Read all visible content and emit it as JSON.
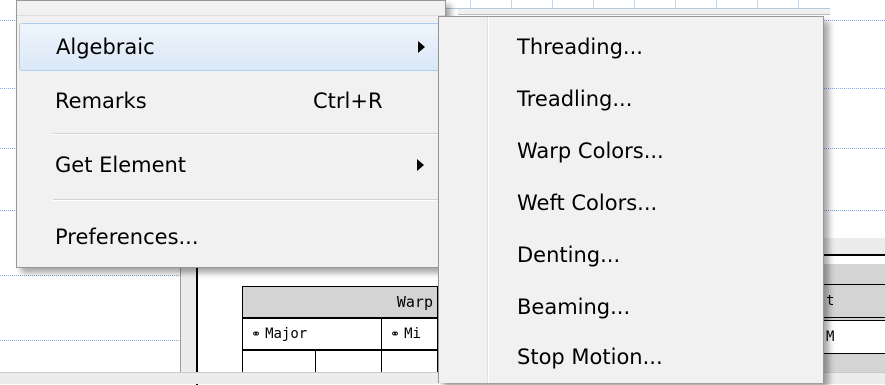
{
  "background": {
    "warp_header": "Warp",
    "col_major": "Major",
    "col_minor": "Mi",
    "lock_glyph": "🔒",
    "right_stub_a": "t",
    "right_stub_b": "M"
  },
  "menu": {
    "items": [
      {
        "label": "Algebraic",
        "shortcut": "",
        "has_submenu": true,
        "highlighted": true
      },
      {
        "label": "Remarks",
        "shortcut": "Ctrl+R",
        "has_submenu": false,
        "highlighted": false
      },
      {
        "label": "Get Element",
        "shortcut": "",
        "has_submenu": true,
        "highlighted": false
      },
      {
        "label": "Preferences...",
        "shortcut": "",
        "has_submenu": false,
        "highlighted": false
      }
    ]
  },
  "submenu": {
    "items": [
      {
        "label": "Threading..."
      },
      {
        "label": "Treadling..."
      },
      {
        "label": "Warp Colors..."
      },
      {
        "label": "Weft Colors..."
      },
      {
        "label": "Denting..."
      },
      {
        "label": "Beaming..."
      },
      {
        "label": "Stop Motion..."
      }
    ]
  },
  "colors": {
    "menu_bg": "#f1f1f1",
    "highlight_border": "#aecdef",
    "highlight_fill": "#dbe8f7",
    "grid_header": "#d4d4d4"
  }
}
